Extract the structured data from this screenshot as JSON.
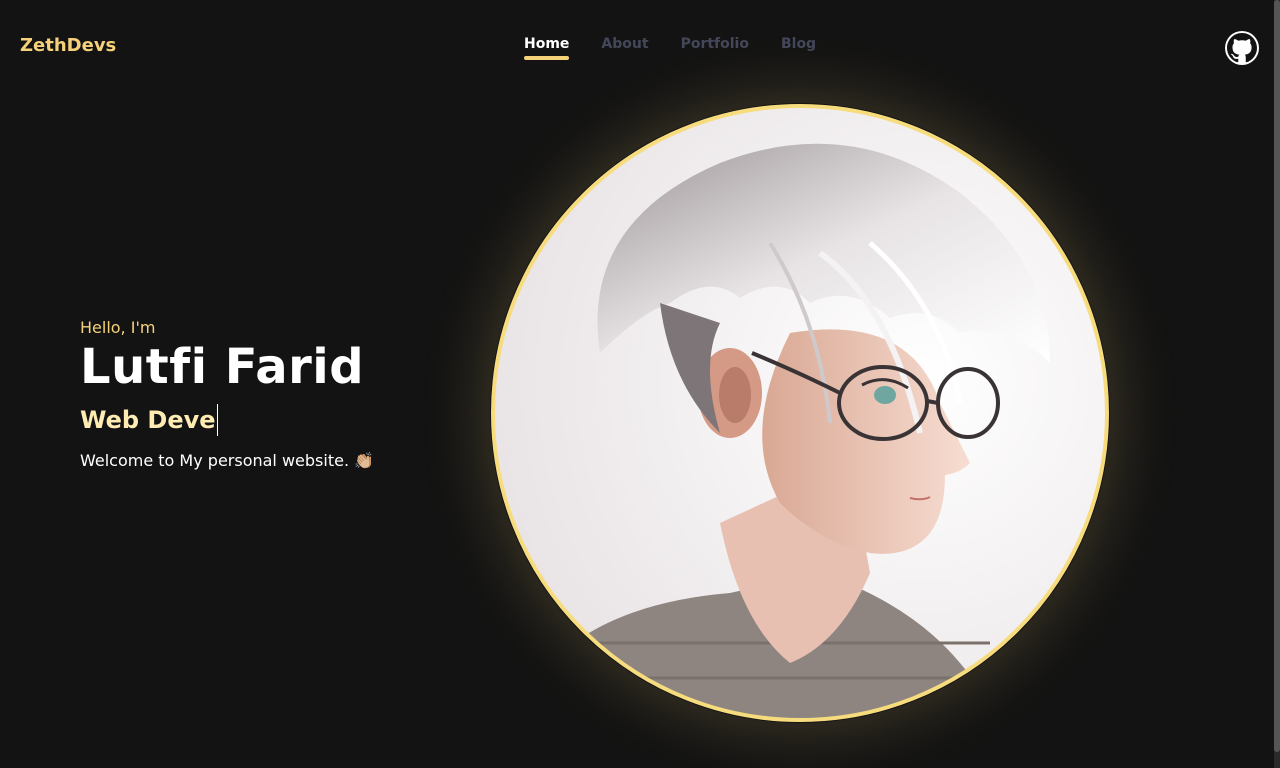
{
  "header": {
    "logo": "ZethDevs",
    "nav": [
      {
        "label": "Home",
        "active": true
      },
      {
        "label": "About",
        "active": false
      },
      {
        "label": "Portfolio",
        "active": false
      },
      {
        "label": "Blog",
        "active": false
      }
    ],
    "github_icon": "github-icon"
  },
  "hero": {
    "greeting": "Hello, I'm",
    "name": "Lutfi Farid",
    "role": "Web Deve",
    "welcome": "Welcome to My personal website. 👏🏼"
  },
  "colors": {
    "background": "#131313",
    "accent": "#f5d27a",
    "nav_inactive": "#44475a",
    "text": "#ffffff"
  }
}
